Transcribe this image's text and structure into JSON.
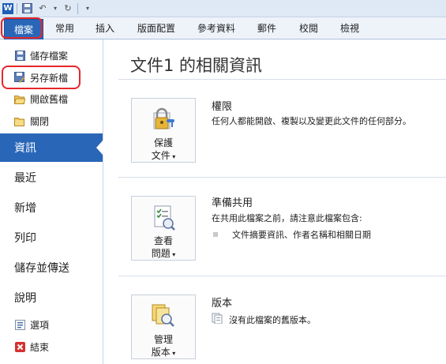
{
  "ribbon": {
    "file_tab": "檔案",
    "tabs": [
      "常用",
      "插入",
      "版面配置",
      "參考資料",
      "郵件",
      "校閱",
      "檢視"
    ]
  },
  "nav": {
    "small_top": [
      {
        "label": "儲存檔案",
        "icon": "save-icon"
      },
      {
        "label": "另存新檔",
        "icon": "save-as-icon"
      },
      {
        "label": "開啟舊檔",
        "icon": "open-folder-icon"
      },
      {
        "label": "關閉",
        "icon": "close-folder-icon"
      }
    ],
    "big": [
      "資訊",
      "最近",
      "新增",
      "列印",
      "儲存並傳送",
      "說明"
    ],
    "selected": "資訊",
    "small_bottom": [
      {
        "label": "選項",
        "icon": "options-icon"
      },
      {
        "label": "結束",
        "icon": "exit-icon"
      }
    ]
  },
  "main": {
    "title": "文件1 的相關資訊",
    "sections": [
      {
        "button_label_1": "保護",
        "button_label_2": "文件",
        "heading": "權限",
        "description": "任何人都能開啟、複製以及變更此文件的任何部分。"
      },
      {
        "button_label_1": "查看",
        "button_label_2": "問題",
        "heading": "準備共用",
        "description": "在共用此檔案之前，請注意此檔案包含:",
        "bullet": "文件摘要資訊、作者名稱和相關日期"
      },
      {
        "button_label_1": "管理",
        "button_label_2": "版本",
        "heading": "版本",
        "description": "沒有此檔案的舊版本。"
      }
    ]
  },
  "colors": {
    "accent": "#2a66b8",
    "highlight": "#e6262b"
  }
}
